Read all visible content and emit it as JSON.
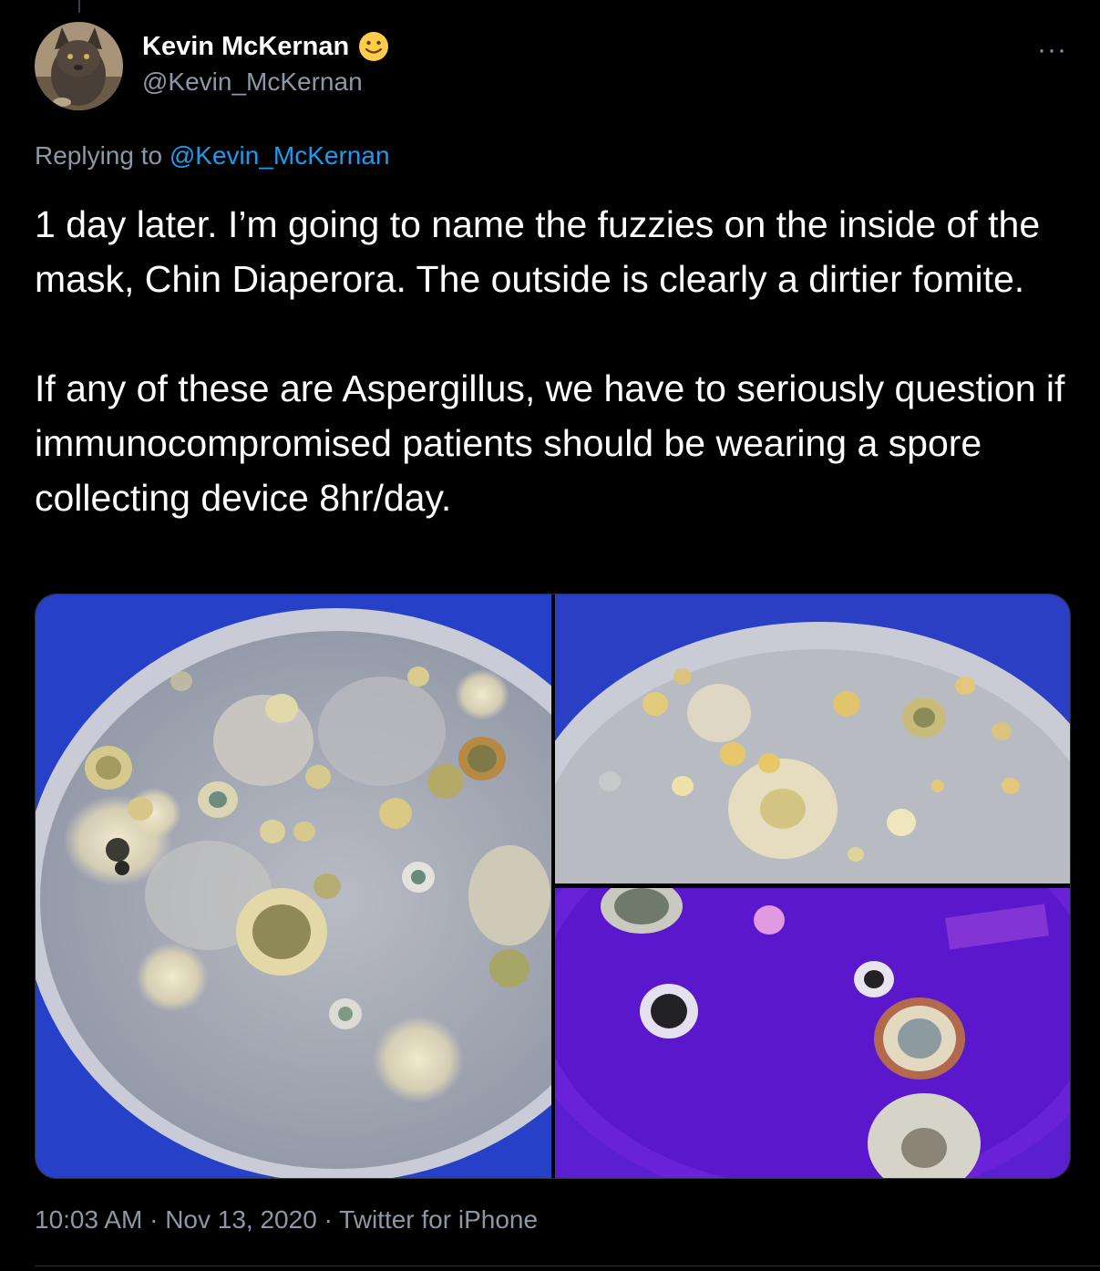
{
  "user": {
    "display_name": "Kevin McKernan",
    "handle": "@Kevin_McKernan"
  },
  "reply": {
    "prefix": "Replying to",
    "target": "@Kevin_McKernan"
  },
  "tweet": {
    "paragraph_1": "1 day later. I’m going to name the fuzzies on the inside of the mask, Chin Diaperora. The outside is clearly a dirtier fomite.",
    "paragraph_2": "If any of these are Aspergillus, we have to seriously question if immunocompromised patients should be wearing a spore collecting device 8hr/day."
  },
  "meta": {
    "time": "10:03 AM",
    "date": "Nov 13, 2020",
    "source": "Twitter for iPhone",
    "separator": "·"
  },
  "icons": {
    "more": "more-horizontal-icon",
    "emoji": "slightly-smiling-face-icon"
  },
  "colors": {
    "background": "#000000",
    "text": "#ffffff",
    "secondary": "#8b98a5",
    "link": "#1d9bf0"
  }
}
